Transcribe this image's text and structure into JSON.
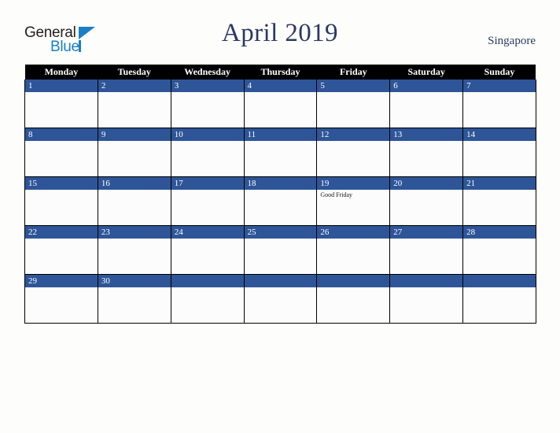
{
  "brand": {
    "name_part1": "General",
    "name_part2": "Blue",
    "accent_color": "#1b7fc4",
    "text_color": "#231f20"
  },
  "header": {
    "title": "April 2019",
    "country": "Singapore",
    "title_color": "#2b3a62"
  },
  "calendar": {
    "weekday_headers": [
      "Monday",
      "Tuesday",
      "Wednesday",
      "Thursday",
      "Friday",
      "Saturday",
      "Sunday"
    ],
    "header_bg": "#000000",
    "daynum_bg": "#2e5597",
    "cell_bg": "#fcfcfc",
    "weeks": [
      [
        {
          "day": "1",
          "event": ""
        },
        {
          "day": "2",
          "event": ""
        },
        {
          "day": "3",
          "event": ""
        },
        {
          "day": "4",
          "event": ""
        },
        {
          "day": "5",
          "event": ""
        },
        {
          "day": "6",
          "event": ""
        },
        {
          "day": "7",
          "event": ""
        }
      ],
      [
        {
          "day": "8",
          "event": ""
        },
        {
          "day": "9",
          "event": ""
        },
        {
          "day": "10",
          "event": ""
        },
        {
          "day": "11",
          "event": ""
        },
        {
          "day": "12",
          "event": ""
        },
        {
          "day": "13",
          "event": ""
        },
        {
          "day": "14",
          "event": ""
        }
      ],
      [
        {
          "day": "15",
          "event": ""
        },
        {
          "day": "16",
          "event": ""
        },
        {
          "day": "17",
          "event": ""
        },
        {
          "day": "18",
          "event": ""
        },
        {
          "day": "19",
          "event": "Good Friday"
        },
        {
          "day": "20",
          "event": ""
        },
        {
          "day": "21",
          "event": ""
        }
      ],
      [
        {
          "day": "22",
          "event": ""
        },
        {
          "day": "23",
          "event": ""
        },
        {
          "day": "24",
          "event": ""
        },
        {
          "day": "25",
          "event": ""
        },
        {
          "day": "26",
          "event": ""
        },
        {
          "day": "27",
          "event": ""
        },
        {
          "day": "28",
          "event": ""
        }
      ],
      [
        {
          "day": "29",
          "event": ""
        },
        {
          "day": "30",
          "event": ""
        },
        {
          "day": "",
          "event": ""
        },
        {
          "day": "",
          "event": ""
        },
        {
          "day": "",
          "event": ""
        },
        {
          "day": "",
          "event": ""
        },
        {
          "day": "",
          "event": ""
        }
      ]
    ]
  }
}
